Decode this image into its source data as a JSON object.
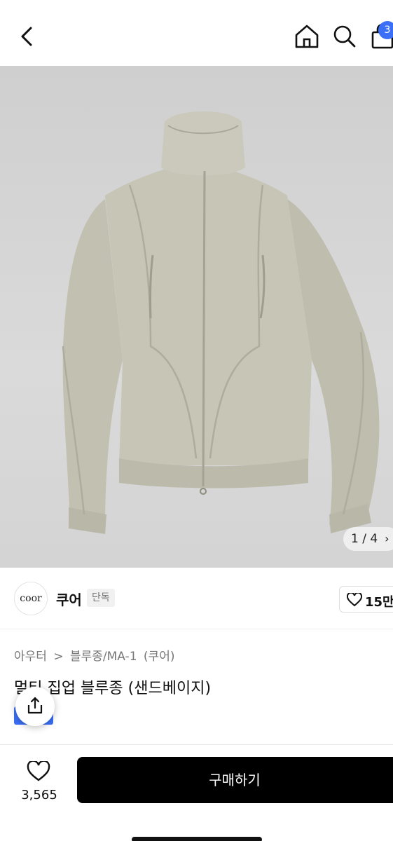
{
  "header": {
    "cart_count": "3"
  },
  "gallery": {
    "pager_text": "1 / 4"
  },
  "brand": {
    "logo_text": "coor",
    "name": "쿠어",
    "tag": "단독",
    "like_count": "15만"
  },
  "product": {
    "breadcrumb": [
      "아우터",
      ">",
      "블루종/MA-1",
      "(쿠어)"
    ],
    "title": "멀티 집업 블루종 (샌드베이지)"
  },
  "footer": {
    "wish_count": "3,565",
    "buy_label": "구매하기"
  },
  "colors": {
    "accent": "#3b6ff5",
    "buy_bg": "#000000",
    "jacket": "#c4c2b3"
  }
}
